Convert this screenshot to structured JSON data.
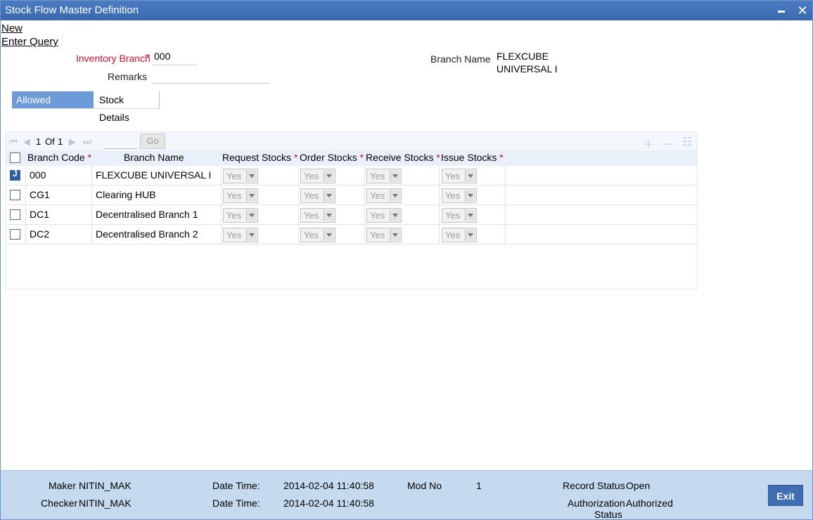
{
  "window": {
    "title": "Stock Flow Master Definition"
  },
  "actions": {
    "new_label": "New",
    "enter_query_label": "Enter Query"
  },
  "form": {
    "inventory_branch_label": "Inventory Branch",
    "inventory_branch_value": "000",
    "required_marker": "*",
    "remarks_label": "Remarks",
    "remarks_value": "",
    "branch_name_label": "Branch Name",
    "branch_name_value": "FLEXCUBE UNIVERSAL I"
  },
  "tabs": [
    {
      "label": "Allowed Branches",
      "active": true
    },
    {
      "label": "Stock Details",
      "active": false
    }
  ],
  "grid": {
    "pagination": {
      "current": "1",
      "of_label": "Of",
      "total": "1",
      "go_label": "Go"
    },
    "headers": {
      "branch_code": "Branch Code",
      "branch_name": "Branch Name",
      "request_stocks": "Request Stocks",
      "order_stocks": "Order Stocks",
      "receive_stocks": "Receive Stocks",
      "issue_stocks": "Issue Stocks",
      "required_marker": "*"
    },
    "rows": [
      {
        "checked": true,
        "code": "000",
        "name": "FLEXCUBE UNIVERSAL I",
        "request": "Yes",
        "order": "Yes",
        "receive": "Yes",
        "issue": "Yes"
      },
      {
        "checked": false,
        "code": "CG1",
        "name": "Clearing HUB",
        "request": "Yes",
        "order": "Yes",
        "receive": "Yes",
        "issue": "Yes"
      },
      {
        "checked": false,
        "code": "DC1",
        "name": "Decentralised Branch 1",
        "request": "Yes",
        "order": "Yes",
        "receive": "Yes",
        "issue": "Yes"
      },
      {
        "checked": false,
        "code": "DC2",
        "name": "Decentralised Branch 2",
        "request": "Yes",
        "order": "Yes",
        "receive": "Yes",
        "issue": "Yes"
      }
    ]
  },
  "footer": {
    "maker_label": "Maker",
    "maker_value": "NITIN_MAK",
    "checker_label": "Checker",
    "checker_value": "NITIN_MAK",
    "date_time_label": "Date Time:",
    "maker_datetime": "2014-02-04 11:40:58",
    "checker_datetime": "2014-02-04 11:40:58",
    "mod_no_label": "Mod No",
    "mod_no_value": "1",
    "record_status_label": "Record Status",
    "record_status_value": "Open",
    "auth_status_label_1": "Authorization",
    "auth_status_label_2": "Status",
    "auth_status_value": "Authorized",
    "exit_label": "Exit"
  },
  "colors": {
    "titlebar": "#3e6eb4",
    "active_tab": "#6d9ad8",
    "required": "#c8102e",
    "footer": "#c5daee"
  }
}
